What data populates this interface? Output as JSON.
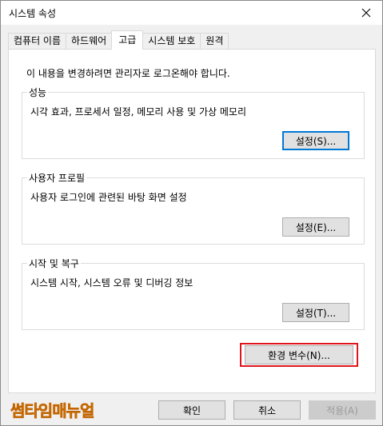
{
  "window": {
    "title": "시스템 속성"
  },
  "tabs": [
    "컴퓨터 이름",
    "하드웨어",
    "고급",
    "시스템 보호",
    "원격"
  ],
  "active_tab": "고급",
  "notice": "이 내용을 변경하려면 관리자로 로그온해야 합니다.",
  "groups": {
    "performance": {
      "label": "성능",
      "description": "시각 효과, 프로세서 일정, 메모리 사용 및 가상 메모리",
      "button": "설정(S)..."
    },
    "profiles": {
      "label": "사용자 프로필",
      "description": "사용자 로그인에 관련된 바탕 화면 설정",
      "button": "설정(E)..."
    },
    "startup": {
      "label": "시작 및 복구",
      "description": "시스템 시작, 시스템 오류 및 디버깅 정보",
      "button": "설정(T)..."
    }
  },
  "env_button": "환경 변수(N)...",
  "footer": {
    "ok": "확인",
    "cancel": "취소",
    "apply": "적용(A)"
  },
  "watermark": "썸타임매뉴얼",
  "colors": {
    "highlight": "#e0161e",
    "watermark": "#ff8a00",
    "focus": "#0078d7"
  }
}
